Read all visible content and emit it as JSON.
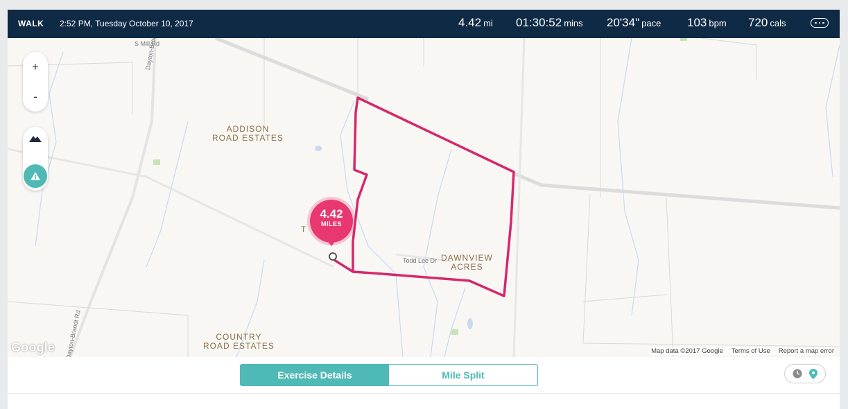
{
  "header": {
    "activity": "WALK",
    "datetime": "2:52 PM, Tuesday October 10, 2017",
    "stats": [
      {
        "value": "4.42",
        "unit": "mi"
      },
      {
        "value": "01:30:52",
        "unit": "mins"
      },
      {
        "value": "20'34\"",
        "unit": "pace"
      },
      {
        "value": "103",
        "unit": "bpm"
      },
      {
        "value": "720",
        "unit": "cals"
      }
    ]
  },
  "map": {
    "places": [
      {
        "text": "ADDISON\nROAD ESTATES"
      },
      {
        "text": "T      ODS"
      },
      {
        "text": "DAWNVIEW\nACRES"
      },
      {
        "text": "COUNTRY\nROAD ESTATES"
      }
    ],
    "roads": [
      "S Mill Rd",
      "Dayton-Brandt",
      "Todd Lee Dr",
      "Dayton-Brandt Rd"
    ],
    "zoom_in": "+",
    "zoom_out": "-",
    "marker": {
      "value": "4.42",
      "unit": "MILES"
    },
    "logo": "Google",
    "attribution": [
      "Map data ©2017 Google",
      "Terms of Use",
      "Report a map error"
    ],
    "route_color": "#d6286a"
  },
  "tabs": [
    {
      "label": "Exercise Details",
      "active": true
    },
    {
      "label": "Mile Split",
      "active": false
    }
  ],
  "colors": {
    "header_bg": "#0e2a45",
    "accent": "#4fb9b6",
    "marker": "#e8386f"
  }
}
